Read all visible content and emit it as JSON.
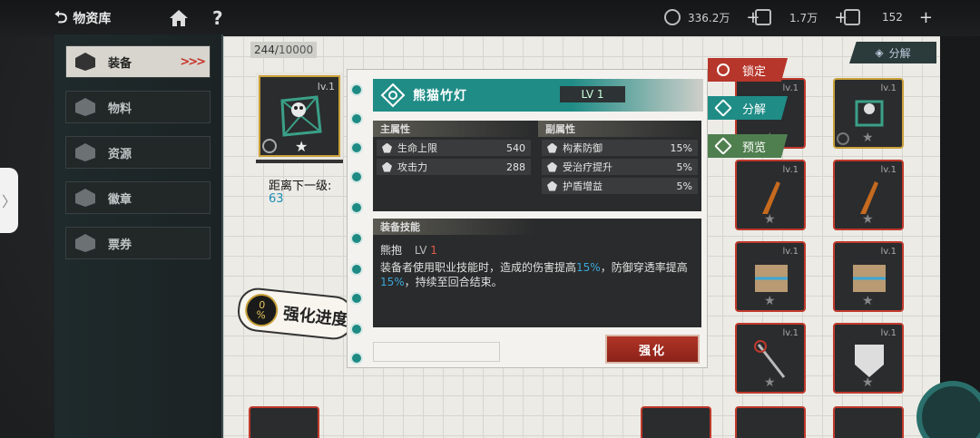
{
  "topbar": {
    "back_label": "物资库",
    "resources": [
      {
        "icon": "coin-icon",
        "value": "336.2万",
        "plus": "+"
      },
      {
        "icon": "chip-icon",
        "value": "1.7万",
        "plus": "+"
      },
      {
        "icon": "crystal-icon",
        "value": "152",
        "plus": "+"
      }
    ]
  },
  "sidebar": {
    "items": [
      {
        "label": "装备",
        "arrows": ">>>"
      },
      {
        "label": "物料"
      },
      {
        "label": "资源"
      },
      {
        "label": "徽章"
      },
      {
        "label": "票券"
      }
    ]
  },
  "inventory": {
    "count_current": "244/",
    "count_max": "10000",
    "split_label": "分解",
    "card_level": "lv.1"
  },
  "selected": {
    "level": "lv.1",
    "next_level_label": "距离下一级:",
    "next_level_value": "63",
    "progress_percent_label": "0",
    "progress_percent_sign": "%",
    "progress_label": "强化进度"
  },
  "detail": {
    "name": "熊猫竹灯",
    "level": "LV 1",
    "main_attr_header": "主属性",
    "sub_attr_header": "副属性",
    "main_attrs": [
      {
        "label": "生命上限",
        "value": "540"
      },
      {
        "label": "攻击力",
        "value": "288"
      }
    ],
    "sub_attrs": [
      {
        "label": "构素防御",
        "value": "15%"
      },
      {
        "label": "受治疗提升",
        "value": "5%"
      },
      {
        "label": "护盾增益",
        "value": "5%"
      }
    ],
    "skill_header": "装备技能",
    "skill_name": "熊抱",
    "skill_lv_text": "LV",
    "skill_lv_num": "1",
    "skill_desc_1": "装备者使用职业技能时，造成的伤害提高",
    "skill_hl_1": "15%",
    "skill_desc_2": "，防御穿透率提高",
    "skill_hl_2": "15%",
    "skill_desc_3": "，持续至回合结束。",
    "enhance_label": "强化"
  },
  "actions": {
    "lock_label": "锁定",
    "split_label": "分解",
    "preview_label": "预览"
  },
  "colors": {
    "accent_teal": "#1f8c86",
    "enhance_red": "#b03427",
    "highlight_blue": "#3aa7d8"
  }
}
